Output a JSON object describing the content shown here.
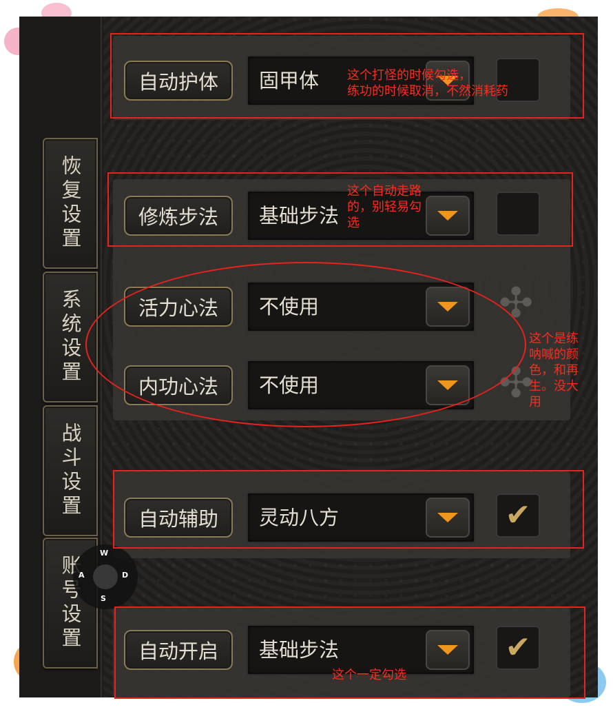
{
  "tabs": [
    {
      "label": "恢复设置"
    },
    {
      "label": "系统设置"
    },
    {
      "label": "战斗设置"
    },
    {
      "label": "账号设置"
    }
  ],
  "rows": [
    {
      "label": "自动护体",
      "value": "固甲体",
      "checked": false
    },
    {
      "label": "修炼步法",
      "value": "基础步法",
      "checked": false
    },
    {
      "label": "活力心法",
      "value": "不使用"
    },
    {
      "label": "内功心法",
      "value": "不使用"
    },
    {
      "label": "自动辅助",
      "value": "灵动八方",
      "checked": true
    },
    {
      "label": "自动开启",
      "value": "基础步法",
      "checked": true
    }
  ],
  "annotations": {
    "note1": "这个打怪的时候勾选，\n练功的时候取消，不然消耗药",
    "note2": "这个自动走路\n的，别轻易勾\n选",
    "note3": "这个是练\n呐喊的颜\n色，和再\n生。没大\n用",
    "note4": "这个一定勾选"
  },
  "joystick": {
    "up": "W",
    "left": "A",
    "right": "D",
    "down": "S"
  },
  "colors": {
    "accent_arrow": "#f0961e",
    "annotation_red": "#e8221c",
    "check_gold": "#c9a860"
  },
  "icons": {
    "check": "✔",
    "ornament": "✣"
  }
}
